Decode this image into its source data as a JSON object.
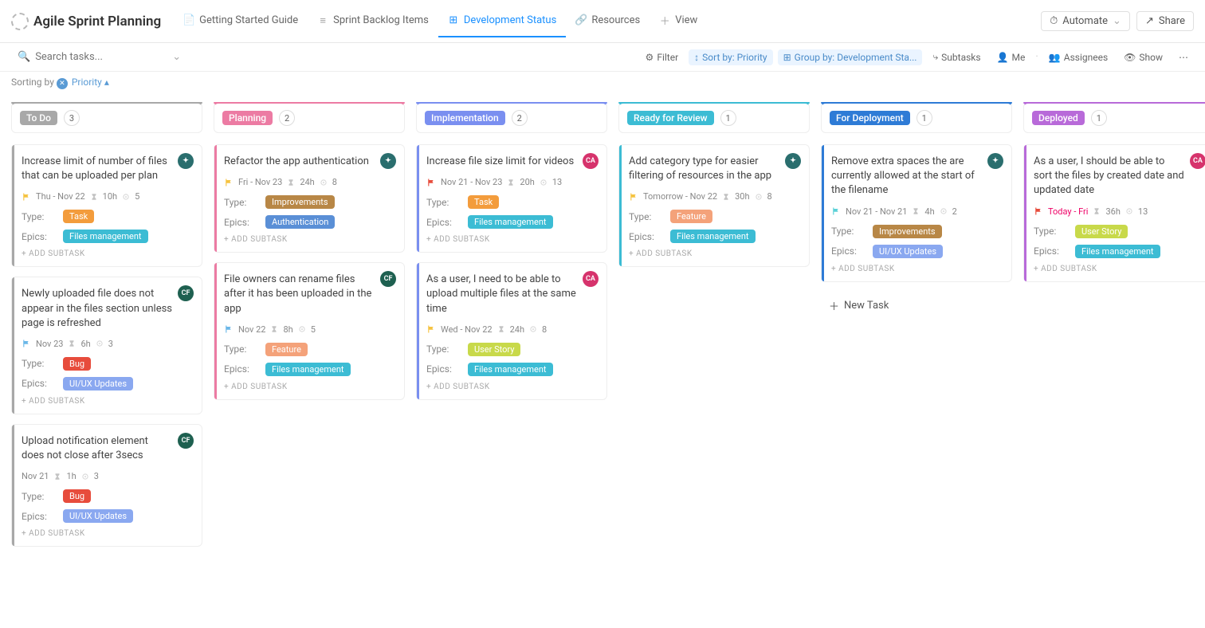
{
  "header": {
    "title": "Agile Sprint Planning",
    "tabs": [
      {
        "label": "Getting Started Guide",
        "icon": "doc"
      },
      {
        "label": "Sprint Backlog Items",
        "icon": "list"
      },
      {
        "label": "Development Status",
        "icon": "board",
        "active": true
      },
      {
        "label": "Resources",
        "icon": "link"
      },
      {
        "label": "View",
        "icon": "plus"
      }
    ],
    "automate": "Automate",
    "share": "Share"
  },
  "toolbar": {
    "search_placeholder": "Search tasks...",
    "filter": "Filter",
    "sort": "Sort by: Priority",
    "group": "Group by: Development Sta...",
    "subtasks": "Subtasks",
    "me": "Me",
    "assignees": "Assignees",
    "show": "Show"
  },
  "sortbar": {
    "prefix": "Sorting by",
    "value": "Priority"
  },
  "labels": {
    "type": "Type:",
    "epics": "Epics:",
    "add_subtask": "+ ADD SUBTASK",
    "new_task": "New Task"
  },
  "tag_colors": {
    "Task": "#f39c3c",
    "Improvements": "#b88746",
    "Feature": "#f4a27a",
    "Bug": "#e74c3c",
    "User Story": "#c8d94a",
    "Files management": "#3cbcd4",
    "Authentication": "#5a8fd6",
    "UI/UX Updates": "#8aa8f0"
  },
  "flag_colors": {
    "yellow": "#f5c340",
    "red": "#e74c3c",
    "blue": "#6ab7e8",
    "cyan": "#5bd1d7"
  },
  "avatar_styles": {
    "team": {
      "bg": "#2a6e6e",
      "txt": "✦"
    },
    "ca": {
      "bg": "#d6336c",
      "txt": "CA"
    },
    "cf": {
      "bg": "#1e6050",
      "txt": "CF"
    }
  },
  "columns": [
    {
      "name": "To Do",
      "color": "#a8a8a8",
      "line": "#a8a8a8",
      "count": 3,
      "cards": [
        {
          "title": "Increase limit of number of files that can be uploaded per plan",
          "avatar": "team",
          "flag": "yellow",
          "dates": "Thu  -  Nov 22",
          "time": "10h",
          "sub": "5",
          "type": "Task",
          "epic": "Files management",
          "bar": "#a8a8a8"
        },
        {
          "title": "Newly uploaded file does not appear in the files section unless page is refreshed",
          "avatar": "cf",
          "flag": "blue",
          "dates": "Nov 23",
          "time": "6h",
          "sub": "3",
          "type": "Bug",
          "epic": "UI/UX Updates",
          "bar": "#a8a8a8"
        },
        {
          "title": "Upload notification element does not close after 3secs",
          "avatar": "cf",
          "flag": "",
          "dates": "Nov 21",
          "time": "1h",
          "sub": "3",
          "type": "Bug",
          "epic": "UI/UX Updates",
          "bar": "#a8a8a8"
        }
      ]
    },
    {
      "name": "Planning",
      "color": "#ec7ba3",
      "line": "#ec7ba3",
      "count": 2,
      "cards": [
        {
          "title": "Refactor the app authentication",
          "avatar": "team",
          "flag": "yellow",
          "dates": "Fri  -  Nov 23",
          "time": "24h",
          "sub": "8",
          "type": "Improvements",
          "epic": "Authentication",
          "bar": "#ec7ba3"
        },
        {
          "title": "File owners can rename files after it has been uploaded in the app",
          "avatar": "cf",
          "flag": "blue",
          "dates": "Nov 22",
          "time": "8h",
          "sub": "5",
          "type": "Feature",
          "epic": "Files management",
          "bar": "#ec7ba3"
        }
      ]
    },
    {
      "name": "Implementation",
      "color": "#7a8ff0",
      "line": "#7a8ff0",
      "count": 2,
      "cards": [
        {
          "title": "Increase file size limit for videos",
          "avatar": "ca",
          "flag": "red",
          "dates": "Nov 21  -  Nov 23",
          "time": "20h",
          "sub": "13",
          "type": "Task",
          "epic": "Files management",
          "bar": "#7a8ff0"
        },
        {
          "title": "As a user, I need to be able to upload multiple files at the same time",
          "avatar": "ca",
          "flag": "yellow",
          "dates": "Wed  -  Nov 22",
          "time": "24h",
          "sub": "8",
          "type": "User Story",
          "epic": "Files management",
          "bar": "#7a8ff0"
        }
      ]
    },
    {
      "name": "Ready for Review",
      "color": "#3cbcd4",
      "line": "#3cbcd4",
      "count": 1,
      "cards": [
        {
          "title": "Add category type for easier filtering of resources in the app",
          "avatar": "team",
          "flag": "yellow",
          "dates": "Tomorrow  -  Nov 22",
          "time": "30h",
          "sub": "8",
          "type": "Feature",
          "epic": "Files management",
          "bar": "#3cbcd4"
        }
      ]
    },
    {
      "name": "For Deployment",
      "color": "#2e7bd6",
      "line": "#2e7bd6",
      "count": 1,
      "new_task": true,
      "cards": [
        {
          "title": "Remove extra spaces the are currently allowed at the start of the filename",
          "avatar": "team",
          "flag": "cyan",
          "dates": "Nov 21  -  Nov 21",
          "time": "4h",
          "sub": "2",
          "type": "Improvements",
          "epic": "UI/UX Updates",
          "bar": "#2e7bd6"
        }
      ]
    },
    {
      "name": "Deployed",
      "color": "#b86ad9",
      "line": "#b86ad9",
      "count": 1,
      "cards": [
        {
          "title": "As a user, I should be able to sort the files by created date and updated date",
          "avatar": "ca",
          "flag": "red",
          "dates": "Today  -  Fri",
          "time": "36h",
          "sub": "13",
          "type": "User Story",
          "epic": "Files management",
          "bar": "#b86ad9",
          "date_color": "#e06"
        }
      ]
    }
  ]
}
